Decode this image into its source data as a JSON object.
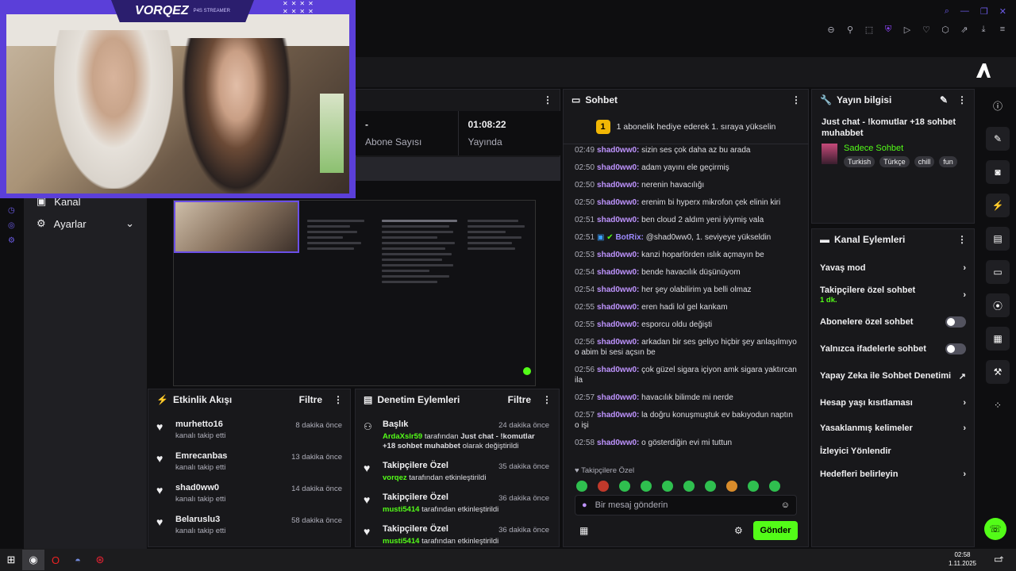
{
  "cam": {
    "title": "VORQEZ",
    "subtitle": "P4S STREAMER"
  },
  "stats": {
    "subs_value": "-",
    "subs_label": "Abone Sayısı",
    "uptime_value": "01:08:22",
    "uptime_label": "Yayında"
  },
  "sidebar": {
    "items": [
      {
        "label": "Kanal"
      },
      {
        "label": "Ayarlar"
      }
    ]
  },
  "chat": {
    "title": "Sohbet",
    "banner": "1 abonelik hediye ederek 1. sıraya yükselin",
    "banner_num": "1",
    "messages": [
      {
        "time": "02:49",
        "user": "shad0ww0:",
        "text": "sizin ses çok daha az bu arada"
      },
      {
        "time": "02:50",
        "user": "shad0ww0:",
        "text": "adam yayını ele geçirmiş"
      },
      {
        "time": "02:50",
        "user": "shad0ww0:",
        "text": "nerenin havacılığı"
      },
      {
        "time": "02:50",
        "user": "shad0ww0:",
        "text": "erenim bi hyperx mikrofon çek elinin kiri"
      },
      {
        "time": "02:51",
        "user": "shad0ww0:",
        "text": "ben cloud 2 aldım yeni iyiymiş vala"
      },
      {
        "time": "02:51",
        "user": "BotRix:",
        "text": "@shad0ww0, 1. seviyeye yükseldin"
      },
      {
        "time": "02:53",
        "user": "shad0ww0:",
        "text": "kanzi hoparlörden ıslık açmayın be"
      },
      {
        "time": "02:54",
        "user": "shad0ww0:",
        "text": "bende havacılık düşünüyom"
      },
      {
        "time": "02:54",
        "user": "shad0ww0:",
        "text": "her şey olabilirim ya belli olmaz"
      },
      {
        "time": "02:55",
        "user": "shad0ww0:",
        "text": "eren hadi lol gel kankam"
      },
      {
        "time": "02:55",
        "user": "shad0ww0:",
        "text": "esporcu oldu değişti"
      },
      {
        "time": "02:56",
        "user": "shad0ww0:",
        "text": "arkadan bir ses geliyo hiçbir şey anlaşılmıyo o abim bi sesi açsın be"
      },
      {
        "time": "02:56",
        "user": "shad0ww0:",
        "text": "çok güzel sigara içiyon amk sigara yaktırcan ila"
      },
      {
        "time": "02:57",
        "user": "shad0ww0:",
        "text": "havacılık bilimde mi nerde"
      },
      {
        "time": "02:57",
        "user": "shad0ww0:",
        "text": "la doğru konuşmuştuk ev bakıyodun naptın o işi"
      },
      {
        "time": "02:58",
        "user": "shad0ww0:",
        "text": "o gösterdiğin evi mi tuttun"
      }
    ],
    "follower_hint": "Takipçilere Özel",
    "placeholder": "Bir mesaj gönderin",
    "send": "Gönder"
  },
  "info": {
    "title": "Yayın bilgisi",
    "stream_title": "Just chat - !komutlar +18 sohbet muhabbet",
    "category": "Sadece Sohbet",
    "tags": [
      "Turkish",
      "Türkçe",
      "chill",
      "fun"
    ]
  },
  "actions": {
    "title": "Kanal Eylemleri",
    "items": [
      {
        "label": "Yavaş mod",
        "sub": ""
      },
      {
        "label": "Takipçilere özel sohbet",
        "sub": "1 dk."
      },
      {
        "label": "Abonelere özel sohbet",
        "sub": ""
      },
      {
        "label": "Yalnızca ifadelerle sohbet",
        "sub": ""
      },
      {
        "label": "Yapay Zeka ile Sohbet Denetimi",
        "sub": ""
      },
      {
        "label": "Hesap yaşı kısıtlaması",
        "sub": ""
      },
      {
        "label": "Yasaklanmış kelimeler",
        "sub": ""
      },
      {
        "label": "İzleyici Yönlendir",
        "sub": ""
      },
      {
        "label": "Hedefleri belirleyin",
        "sub": ""
      }
    ]
  },
  "feed": {
    "title": "Etkinlik Akışı",
    "filter": "Filtre",
    "items": [
      {
        "name": "murhetto16",
        "sub": "kanalı takip etti",
        "time": "8 dakika önce"
      },
      {
        "name": "Emrecanbas",
        "sub": "kanalı takip etti",
        "time": "13 dakika önce"
      },
      {
        "name": "shad0ww0",
        "sub": "kanalı takip etti",
        "time": "14 dakika önce"
      },
      {
        "name": "Belaruslu3",
        "sub": "kanalı takip etti",
        "time": "58 dakika önce"
      }
    ]
  },
  "mod": {
    "title": "Denetim Eylemleri",
    "filter": "Filtre",
    "items": [
      {
        "name": "Başlık",
        "user": "ArdaXslr59",
        "mid": "tarafından",
        "bold": "Just chat - !komutlar +18 sohbet muhabbet",
        "tail": "olarak değiştirildi",
        "time": "24 dakika önce"
      },
      {
        "name": "Takipçilere Özel",
        "user": "vorqez",
        "mid": "tarafından etkinleştirildi",
        "bold": "",
        "tail": "",
        "time": "35 dakika önce"
      },
      {
        "name": "Takipçilere Özel",
        "user": "musti5414",
        "mid": "tarafından etkinleştirildi",
        "bold": "",
        "tail": "",
        "time": "36 dakika önce"
      },
      {
        "name": "Takipçilere Özel",
        "user": "musti5414",
        "mid": "tarafından etkinleştirildi",
        "bold": "",
        "tail": "",
        "time": "36 dakika önce"
      }
    ]
  },
  "taskbar": {
    "time": "02:58",
    "date": "1.11.2025"
  },
  "colors": {
    "accent": "#53fc18",
    "cam_frame": "#5b3fd9",
    "panel": "#18181b",
    "bg": "#0e0e10"
  }
}
